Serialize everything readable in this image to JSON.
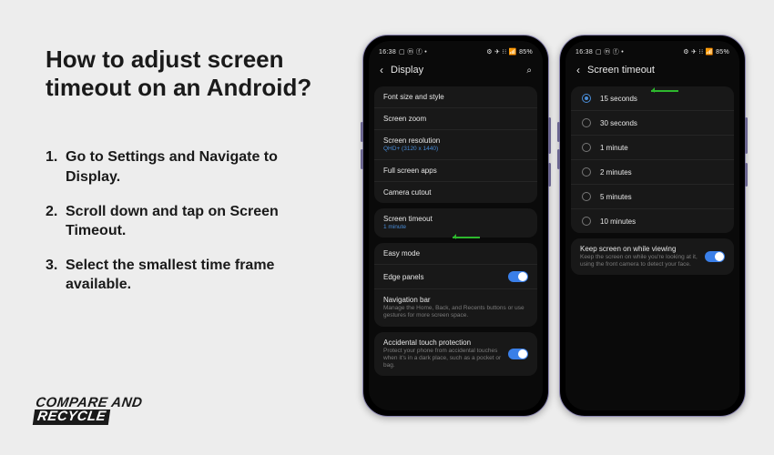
{
  "title": "How to adjust screen timeout on an Android?",
  "steps": [
    "Go to Settings and Navigate to Display.",
    "Scroll down and tap on Screen Timeout.",
    "Select  the smallest time frame available."
  ],
  "logo": {
    "line1": "COMPARE AND",
    "line2": "RECYCLE"
  },
  "status": {
    "time": "16:38",
    "left_icons": "▢ ⓜ ⓕ •",
    "right_icons": "⚙ ✈ ⁝⁝ 📶 85%"
  },
  "phone1": {
    "title": "Display",
    "rows": {
      "font": "Font size and style",
      "zoom": "Screen zoom",
      "res": "Screen resolution",
      "res_sub": "QHD+ (3120 x 1440)",
      "full": "Full screen apps",
      "cutout": "Camera cutout",
      "timeout": "Screen timeout",
      "timeout_sub": "1 minute",
      "easy": "Easy mode",
      "edge": "Edge panels",
      "nav": "Navigation bar",
      "nav_sub": "Manage the Home, Back, and Recents buttons or use gestures for more screen space.",
      "touch": "Accidental touch protection",
      "touch_sub": "Protect your phone from accidental touches when it's in a dark place, such as a pocket or bag."
    }
  },
  "phone2": {
    "title": "Screen timeout",
    "options": [
      "15 seconds",
      "30 seconds",
      "1 minute",
      "2 minutes",
      "5 minutes",
      "10 minutes"
    ],
    "keep_title": "Keep screen on while viewing",
    "keep_sub": "Keep the screen on while you're looking at it, using the front camera to detect your face."
  }
}
